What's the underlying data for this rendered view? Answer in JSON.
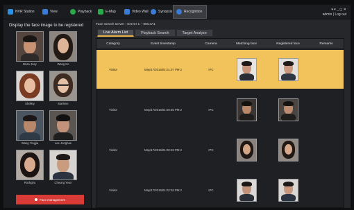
{
  "app": {
    "title": "NVR Station"
  },
  "topbar": {
    "items": [
      {
        "label": "NVR Station",
        "color": "#2f8fe0"
      },
      {
        "label": "View",
        "color": "#3a7bd5"
      },
      {
        "label": "Playback",
        "color": "#2aa84a"
      },
      {
        "label": "E-Map",
        "color": "#2aa84a"
      },
      {
        "label": "Video Wall",
        "color": "#3a7bd5"
      },
      {
        "label": "Synopsis",
        "color": "#3a7bd5"
      },
      {
        "label": "Recognition",
        "color": "#3a7bd5"
      }
    ],
    "user": "admin",
    "logout": "Log out",
    "window_controls": "▾ ▾ _ ◻ ✕"
  },
  "left_panel": {
    "title": "Display the face image to be registered",
    "faces": [
      {
        "name": "Brian Joey"
      },
      {
        "name": "Wang Ke"
      },
      {
        "name": "Shelley"
      },
      {
        "name": "Marlene"
      },
      {
        "name": "Wang Yingjia"
      },
      {
        "name": "Lee Jonghae"
      },
      {
        "name": "Rockgiru"
      },
      {
        "name": "Cheung Yeun"
      }
    ],
    "button_label": "Face management"
  },
  "right_panel": {
    "server_line": "Face search server : Server 1 – 00C4A1",
    "tabs": [
      {
        "label": "Live Alarm List",
        "active": true
      },
      {
        "label": "Playback Search",
        "active": false
      },
      {
        "label": "Target Analyze",
        "active": false
      }
    ],
    "table": {
      "columns": [
        "Category",
        "Event timestamp",
        "Camera",
        "Matching face",
        "Registered face",
        "Remarks"
      ],
      "rows": [
        {
          "category": "Visitor",
          "timestamp": "May/17/2016/01:01:07  PM  2",
          "camera": "IPC",
          "remarks": "",
          "selected": true
        },
        {
          "category": "Visitor",
          "timestamp": "May/17/2016/01:00:55  PM  2",
          "camera": "IPC",
          "remarks": "",
          "selected": false
        },
        {
          "category": "Visitor",
          "timestamp": "May/17/2016/01:00:49  PM  2",
          "camera": "IPC",
          "remarks": "",
          "selected": false
        },
        {
          "category": "Visitor",
          "timestamp": "May/17/2016/01:02:03  PM  2",
          "camera": "IPC",
          "remarks": "",
          "selected": false
        }
      ]
    }
  },
  "colors": {
    "accent": "#f1c35a",
    "button_red": "#d83a35"
  }
}
